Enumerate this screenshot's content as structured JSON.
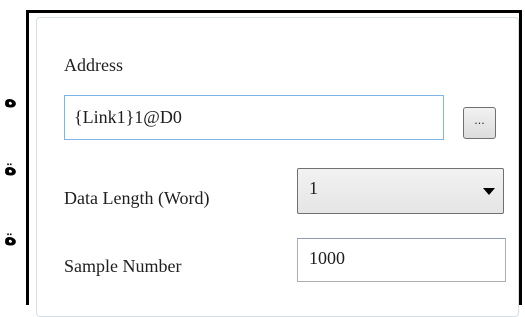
{
  "address": {
    "label": "Address",
    "value": "{Link1}1@D0",
    "browse_label": "..."
  },
  "data_length": {
    "label": "Data Length (Word)",
    "selected": "1"
  },
  "sample_number": {
    "label": "Sample Number",
    "value": "1000"
  },
  "side_text": {
    "glyph_1": "ه",
    "glyph_2": "ة",
    "glyph_3": "ة"
  },
  "colors": {
    "panel_border": "#000000",
    "focused_input_border": "#7eb4ea",
    "input_border": "#abadb3",
    "text": "#1e1e1e"
  }
}
